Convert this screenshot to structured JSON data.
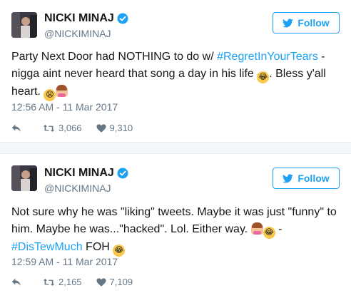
{
  "tweets": [
    {
      "display_name": "NICKI MINAJ",
      "handle": "@NICKIMINAJ",
      "follow_label": "Follow",
      "text_1": "Party Next Door had NOTHING to do w/ ",
      "hashtag_1": "#RegretInYourTears",
      "text_2": " - nigga aint never heard that song a day in his life ",
      "text_3": ". Bless y'all heart. ",
      "emojis": [
        "face-with-tears-of-joy",
        "weary-face",
        "woman-shrugging"
      ],
      "time": "12:56 AM - 11 Mar 2017",
      "retweets": "3,066",
      "likes": "9,310"
    },
    {
      "display_name": "NICKI MINAJ",
      "handle": "@NICKIMINAJ",
      "follow_label": "Follow",
      "text_1": "Not sure why he was \"liking\" tweets. Maybe it was just \"funny\" to him. Maybe he was...\"hacked\". Lol. Either way. ",
      "text_2": " - ",
      "hashtag_1": "#DisTewMuch",
      "text_3": " FOH ",
      "emojis": [
        "woman-shrugging",
        "face-with-tears-of-joy",
        "face-with-tears-of-joy"
      ],
      "time": "12:59 AM - 11 Mar 2017",
      "retweets": "2,165",
      "likes": "7,109"
    }
  ],
  "colors": {
    "accent": "#1da1f2",
    "muted": "#657786",
    "text": "#14171a",
    "separator": "#f5f8fa"
  }
}
